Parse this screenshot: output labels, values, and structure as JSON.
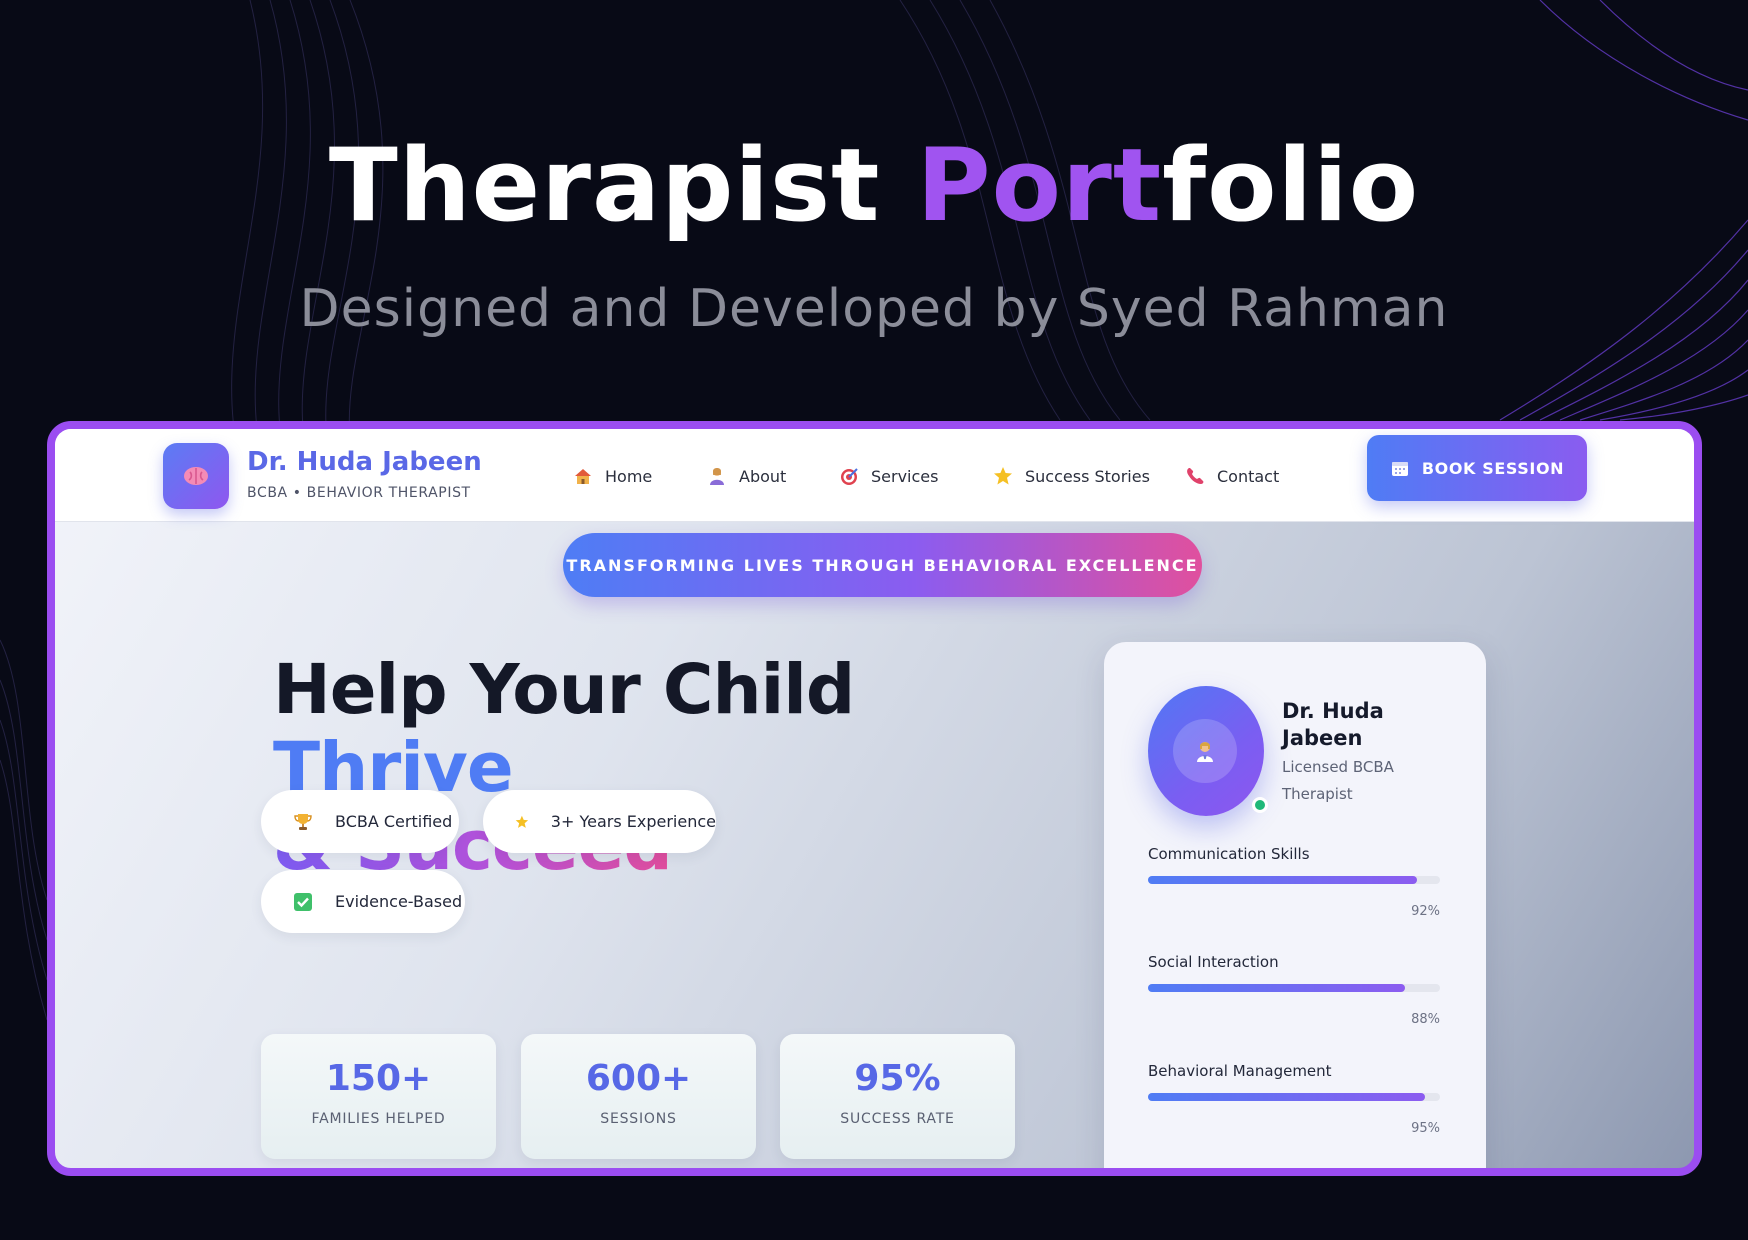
{
  "poster": {
    "title_part1": "Therapist ",
    "title_part2": "Port",
    "title_part3": "folio",
    "subtitle": "Designed and Developed by Syed Rahman"
  },
  "nav": {
    "brand_name": "Dr. Huda Jabeen",
    "brand_sub": "BCBA • BEHAVIOR THERAPIST",
    "logo_icon": "brain-icon",
    "items": [
      {
        "label": "Home",
        "icon": "house-icon"
      },
      {
        "label": "About",
        "icon": "person-icon"
      },
      {
        "label": "Services",
        "icon": "target-icon"
      },
      {
        "label": "Success Stories",
        "icon": "star-icon"
      },
      {
        "label": "Contact",
        "icon": "phone-icon"
      }
    ],
    "cta": {
      "label": "BOOK SESSION",
      "icon": "calendar-icon"
    }
  },
  "banner": "TRANSFORMING LIVES THROUGH BEHAVIORAL EXCELLENCE",
  "headline": {
    "part1": "Help Your Child ",
    "part2": "Thrive",
    "part3": "& Succeed"
  },
  "badges": [
    {
      "label": "BCBA Certified",
      "icon": "trophy-icon"
    },
    {
      "label": "3+ Years Experience",
      "icon": "star-icon"
    },
    {
      "label": "Evidence-Based",
      "icon": "checkmark-icon"
    }
  ],
  "stats": [
    {
      "value": "150+",
      "label": "FAMILIES HELPED"
    },
    {
      "value": "600+",
      "label": "SESSIONS"
    },
    {
      "value": "95%",
      "label": "SUCCESS RATE"
    }
  ],
  "profile": {
    "name": "Dr. Huda Jabeen",
    "role": "Licensed BCBA Therapist",
    "avatar_icon": "doctor-icon",
    "status": "online",
    "skills": [
      {
        "label": "Communication Skills",
        "value": 92,
        "display": "92%"
      },
      {
        "label": "Social Interaction",
        "value": 88,
        "display": "88%"
      },
      {
        "label": "Behavioral Management",
        "value": 95,
        "display": "95%"
      }
    ]
  },
  "colors": {
    "accent_purple": "#9b4df1",
    "accent_blue": "#4f7cf4",
    "accent_pink": "#e04d9c",
    "page_bg": "#080a16"
  }
}
